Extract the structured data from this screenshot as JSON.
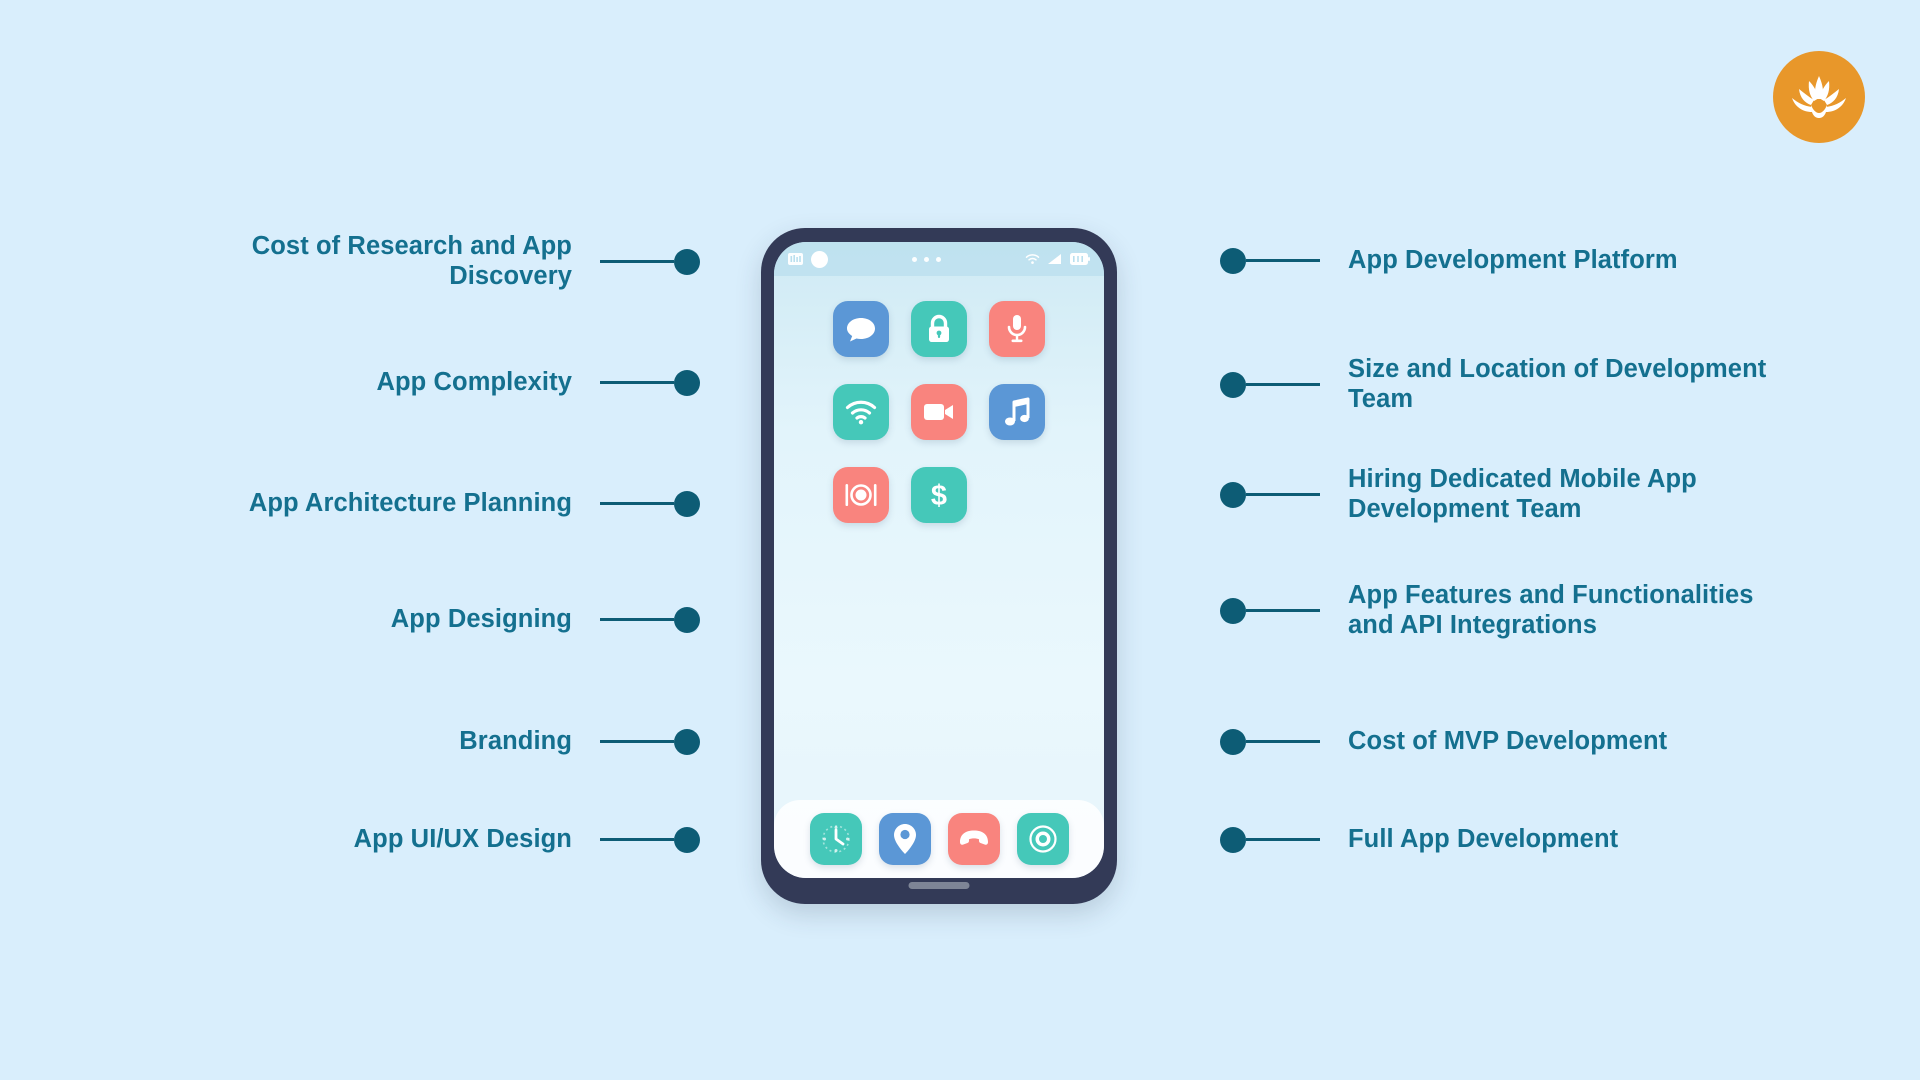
{
  "background_color": "#d9eefc",
  "brand": {
    "logo_icon": "lotus-flower-icon",
    "logo_background_color": "#e8972a",
    "logo_mark_color": "#ffffff"
  },
  "theme": {
    "label_color": "#14708f",
    "connector_color": "#0d5c75",
    "phone_frame_color": "#333a57",
    "accent_blue": "#5b97d6",
    "accent_teal": "#45c8b9",
    "accent_salmon": "#f9847e"
  },
  "left_column": {
    "items": [
      {
        "label": "Cost of Research and App Discovery"
      },
      {
        "label": "App Complexity"
      },
      {
        "label": "App Architecture Planning"
      },
      {
        "label": "App Designing"
      },
      {
        "label": "Branding"
      },
      {
        "label": "App UI/UX Design"
      }
    ]
  },
  "right_column": {
    "items": [
      {
        "label": "App Development Platform"
      },
      {
        "label": "Size and Location of Development Team"
      },
      {
        "label": "Hiring Dedicated Mobile App Development Team"
      },
      {
        "label": "App Features and Functionalities and API Integrations"
      },
      {
        "label": "Cost of MVP Development"
      },
      {
        "label": "Full App Development"
      }
    ]
  },
  "phone": {
    "status_bar": {
      "left_icons": [
        "signal-bars-icon",
        "front-camera-icon"
      ],
      "center_icons": [
        "dot-icon",
        "dot-icon",
        "dot-icon"
      ],
      "right_icons": [
        "wifi-icon",
        "cellular-signal-icon",
        "battery-icon"
      ]
    },
    "home_screen_apps": [
      {
        "name": "messages-app-icon",
        "glyph": "chat-bubble-icon",
        "color": "#5b97d6"
      },
      {
        "name": "security-app-icon",
        "glyph": "lock-icon",
        "color": "#45c8b9"
      },
      {
        "name": "voice-app-icon",
        "glyph": "microphone-icon",
        "color": "#f9847e"
      },
      {
        "name": "wifi-app-icon",
        "glyph": "wifi-icon",
        "color": "#45c8b9"
      },
      {
        "name": "video-app-icon",
        "glyph": "video-camera-icon",
        "color": "#f9847e"
      },
      {
        "name": "music-app-icon",
        "glyph": "music-note-icon",
        "color": "#5b97d6"
      },
      {
        "name": "food-app-icon",
        "glyph": "dining-plate-icon",
        "color": "#f9847e"
      },
      {
        "name": "payments-app-icon",
        "glyph": "dollar-sign-icon",
        "color": "#45c8b9"
      }
    ],
    "dock_apps": [
      {
        "name": "clock-app-icon",
        "glyph": "clock-icon",
        "color": "#45c8b9"
      },
      {
        "name": "maps-app-icon",
        "glyph": "location-pin-icon",
        "color": "#5b97d6"
      },
      {
        "name": "phone-app-icon",
        "glyph": "phone-handset-icon",
        "color": "#f9847e"
      },
      {
        "name": "camera-app-icon",
        "glyph": "camera-lens-icon",
        "color": "#45c8b9"
      }
    ],
    "home_indicator": "home-indicator-bar"
  }
}
